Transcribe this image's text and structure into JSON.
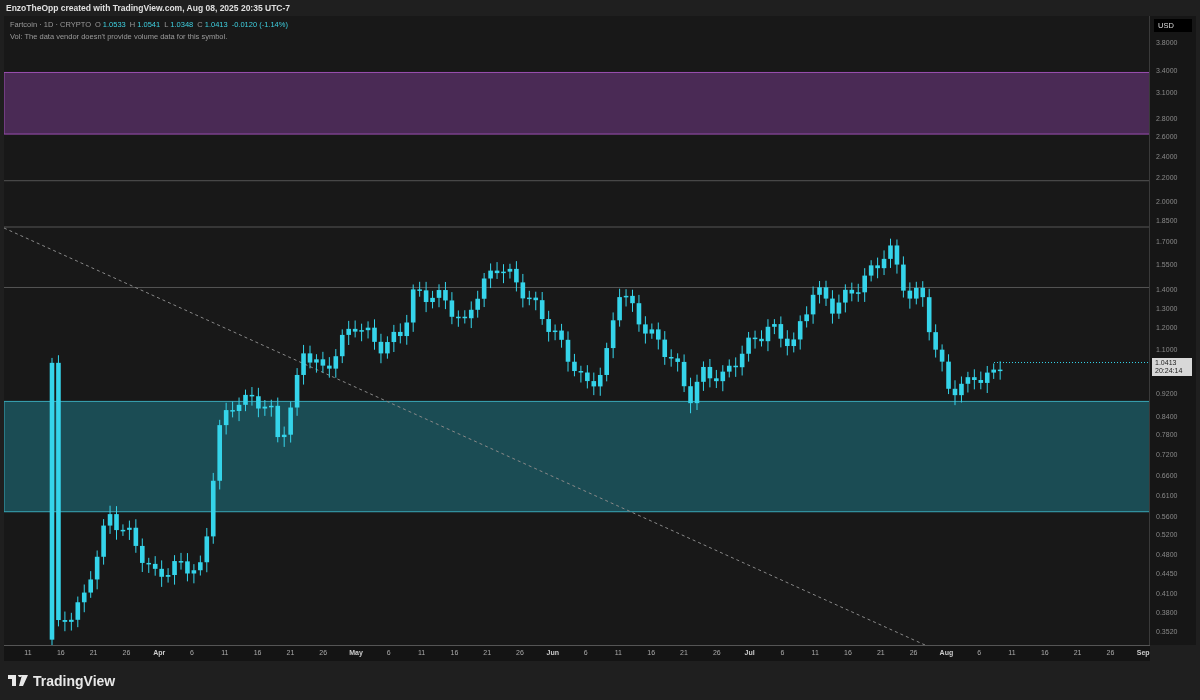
{
  "header": {
    "author_line": "EnzoTheOpp created with TradingView.com, Aug 08, 2025 20:35 UTC-7"
  },
  "legend": {
    "symbol": "Fartcoin · 1D · CRYPTO",
    "ohlc": [
      {
        "label": "O",
        "value": "1.0533"
      },
      {
        "label": "H",
        "value": "1.0541"
      },
      {
        "label": "L",
        "value": "1.0348"
      },
      {
        "label": "C",
        "value": "1.0413"
      }
    ],
    "change": "-0.0120 (-1.14%)",
    "volume_note": "Vol: The data vendor doesn't provide volume data for this symbol."
  },
  "price_axis": {
    "currency": "USD",
    "labels": [
      "3.8000",
      "3.4000",
      "3.1000",
      "2.8000",
      "2.6000",
      "2.4000",
      "2.2000",
      "2.0000",
      "1.8500",
      "1.7000",
      "1.5500",
      "1.4000",
      "1.3000",
      "1.2000",
      "1.1000",
      "0.9200",
      "0.8400",
      "0.7800",
      "0.7200",
      "0.6600",
      "0.6100",
      "0.5600",
      "0.5200",
      "0.4800",
      "0.4450",
      "0.4100",
      "0.3800",
      "0.3520"
    ],
    "last_price": {
      "value": "1.0413",
      "countdown": "20:24:14"
    }
  },
  "time_axis": {
    "labels": [
      "11",
      "16",
      "21",
      "26",
      "Apr",
      "6",
      "11",
      "16",
      "21",
      "26",
      "May",
      "6",
      "11",
      "16",
      "21",
      "26",
      "Jun",
      "6",
      "11",
      "16",
      "21",
      "26",
      "Jul",
      "6",
      "11",
      "16",
      "21",
      "26",
      "Aug",
      "6",
      "11",
      "16",
      "21",
      "26",
      "Sep"
    ]
  },
  "footer": {
    "brand": "TradingView"
  }
}
